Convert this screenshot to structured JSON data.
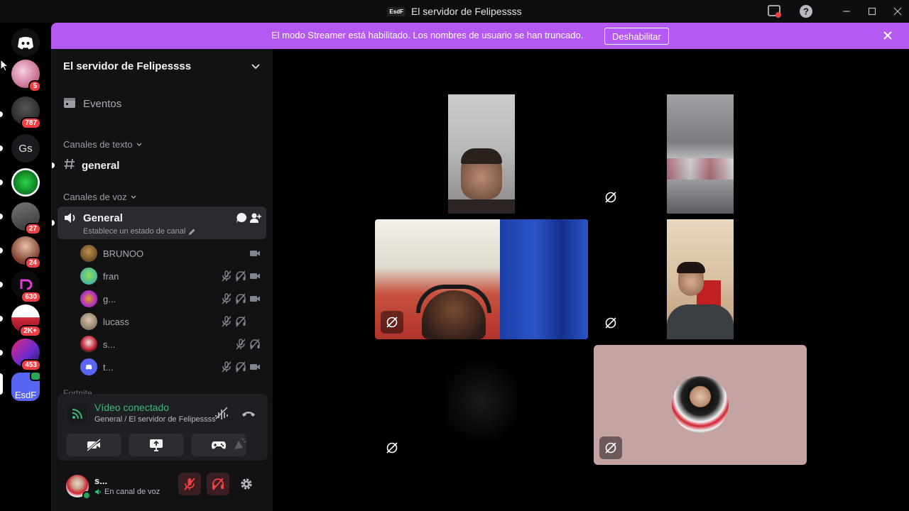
{
  "window": {
    "title": "El servidor de Felipessss",
    "badge": "EsdF"
  },
  "banner": {
    "message": "El modo Streamer está habilitado. Los nombres de usuario se han truncado.",
    "button_label": "Deshabilitar"
  },
  "guilds": [
    {
      "name": "guild-1",
      "badge": "5"
    },
    {
      "name": "guild-2",
      "badge": "787"
    },
    {
      "name": "guild-gs",
      "initials": "Gs",
      "badge": ""
    },
    {
      "name": "guild-4",
      "badge": ""
    },
    {
      "name": "guild-5",
      "badge": "27"
    },
    {
      "name": "guild-6",
      "badge": "24"
    },
    {
      "name": "guild-7",
      "badge": "630"
    },
    {
      "name": "guild-8",
      "badge": "2K+"
    },
    {
      "name": "guild-9",
      "badge": "453"
    },
    {
      "name": "guild-esdf",
      "initials": "EsdF",
      "badge": ""
    }
  ],
  "sidebar": {
    "server_name": "El servidor de Felipessss",
    "events_label": "Eventos",
    "text_category": "Canales de texto",
    "text_channel": "general",
    "voice_category": "Canales de voz",
    "voice_channel": "General",
    "voice_status_hint": "Establece un estado de canal",
    "more_category": "Fortnite"
  },
  "participants": [
    {
      "name": "BRUNOO",
      "icons": [
        "video-icon"
      ]
    },
    {
      "name": "fran",
      "icons": [
        "mic-muted-icon",
        "headphones-deafened-icon",
        "video-icon"
      ]
    },
    {
      "name": "g...",
      "icons": [
        "mic-muted-icon",
        "headphones-deafened-icon",
        "video-icon"
      ]
    },
    {
      "name": "lucass",
      "icons": [
        "mic-muted-icon",
        "headphones-deafened-icon"
      ]
    },
    {
      "name": "s...",
      "icons": [
        "mic-muted-icon",
        "headphones-deafened-icon"
      ]
    },
    {
      "name": "t...",
      "icons": [
        "mic-muted-icon",
        "headphones-deafened-icon",
        "video-icon"
      ]
    }
  ],
  "voice_panel": {
    "status": "Vídeo conectado",
    "location": "General / El servidor de Felipessss"
  },
  "user": {
    "name": "s...",
    "status": "En canal de voz"
  },
  "colors": {
    "accent_banner": "#b45af2",
    "connected_green": "#3fb877",
    "danger_red": "#f23f43",
    "sidebar_bg": "#121214",
    "tile_pink": "#c4a4a2"
  }
}
